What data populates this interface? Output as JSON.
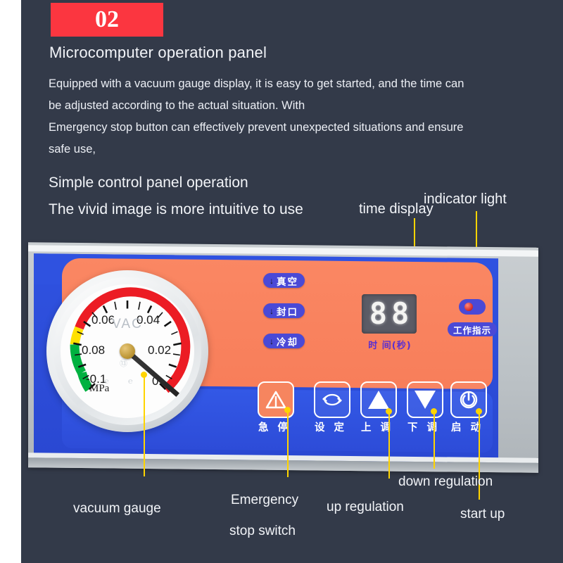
{
  "header": {
    "badge_number": "02",
    "title": "Microcomputer operation panel",
    "body_lines": [
      "Equipped with a vacuum gauge display, it is easy to get started, and the time can",
      "be adjusted according to the actual situation. With",
      "Emergency stop button can effectively prevent unexpected situations and ensure",
      "safe use,"
    ],
    "subtitle_1": "Simple control panel operation",
    "subtitle_2": "The vivid image is more intuitive to use"
  },
  "callouts": {
    "time_display": "time display",
    "indicator_light": "indicator light",
    "vacuum_gauge": "vacuum gauge",
    "emergency_line1": "Emergency",
    "emergency_line2": "stop switch",
    "up_regulation": "up regulation",
    "down_regulation": "down regulation",
    "start_up": "start up"
  },
  "gauge": {
    "brand": "VAC",
    "unit": "MPa",
    "tick_labels": [
      "0.06",
      "0.04",
      "0.02",
      "0",
      "-0.1",
      "0.08"
    ],
    "zones": [
      {
        "name": "red-zone",
        "color": "#ec1c24"
      },
      {
        "name": "yellow-zone",
        "color": "#ffe000"
      },
      {
        "name": "green-zone",
        "color": "#00b140"
      }
    ],
    "needle_value": "0"
  },
  "indicators": [
    {
      "name": "vacuum",
      "label": "真空",
      "arrow": "↓"
    },
    {
      "name": "sealing",
      "label": "封口",
      "arrow": "↓"
    },
    {
      "name": "cooling",
      "label": "冷却",
      "arrow": "↓"
    }
  ],
  "display": {
    "value_digit_1": "8",
    "value_digit_2": "8",
    "label": "时 间(秒)"
  },
  "indicator_light": {
    "label": "工作指示",
    "led_color": "#d22626"
  },
  "buttons": [
    {
      "name": "emergency-stop",
      "label": "急 停",
      "icon": "warning-triangle-icon"
    },
    {
      "name": "setting",
      "label": "设 定",
      "icon": "cycle-arrows-icon"
    },
    {
      "name": "up-adjust",
      "label": "上 调",
      "icon": "triangle-up-icon"
    },
    {
      "name": "down-adjust",
      "label": "下 调",
      "icon": "triangle-down-icon"
    },
    {
      "name": "start",
      "label": "启 动",
      "icon": "power-icon"
    }
  ],
  "colors": {
    "background": "#333a49",
    "badge": "#fb3640",
    "panel_orange": "#f9815f",
    "panel_blue": "#2f52e0",
    "callout": "#ffd400"
  }
}
